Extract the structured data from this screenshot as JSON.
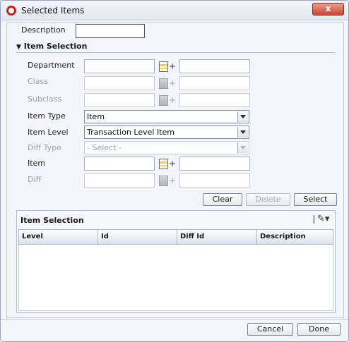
{
  "window": {
    "title": "Selected Items",
    "close_label": "x"
  },
  "form": {
    "description_label": "Description",
    "description_value": "",
    "section_title": "Item Selection",
    "department_label": "Department",
    "class_label": "Class",
    "subclass_label": "Subclass",
    "item_type_label": "Item Type",
    "item_type_value": "Item",
    "item_level_label": "Item Level",
    "item_level_value": "Transaction Level Item",
    "diff_type_label": "Diff Type",
    "diff_type_value": "- Select -",
    "item_label": "Item",
    "diff_label": "Diff"
  },
  "actions": {
    "clear": "Clear",
    "delete": "Delete",
    "select": "Select"
  },
  "table": {
    "title": "Item Selection",
    "columns": [
      "Level",
      "Id",
      "Diff Id",
      "Description"
    ],
    "rows": []
  },
  "footer": {
    "cancel": "Cancel",
    "done": "Done"
  },
  "colors": {
    "accent": "#c7210f",
    "panel_bg": "#f4f5fb",
    "lov_icon": "#f6d34a"
  },
  "icons": {
    "app": "oracle-logo-icon",
    "lov": "list-of-values-icon",
    "edit": "pencil-icon",
    "expand": "triangle-down-icon"
  }
}
